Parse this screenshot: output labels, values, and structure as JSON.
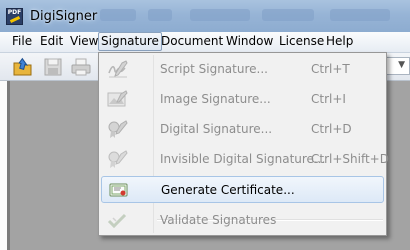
{
  "window": {
    "title": "DigiSigner",
    "app_icon_text": "PDF"
  },
  "menubar": {
    "items": [
      "File",
      "Edit",
      "View",
      "Signature",
      "Document",
      "Window",
      "License",
      "Help"
    ],
    "active": "Signature"
  },
  "signature_menu": {
    "items": [
      {
        "label": "Script Signature...",
        "shortcut": "Ctrl+T",
        "enabled": false,
        "icon": "script-signature-icon"
      },
      {
        "label": "Image Signature...",
        "shortcut": "Ctrl+I",
        "enabled": false,
        "icon": "image-signature-icon"
      },
      {
        "label": "Digital Signature...",
        "shortcut": "Ctrl+D",
        "enabled": false,
        "icon": "digital-signature-icon"
      },
      {
        "label": "Invisible Digital Signature...",
        "shortcut": "Ctrl+Shift+D",
        "enabled": false,
        "icon": "invisible-signature-icon"
      },
      {
        "label": "Generate Certificate...",
        "shortcut": "",
        "enabled": true,
        "highlighted": true,
        "icon": "certificate-icon"
      },
      {
        "label": "Validate Signatures",
        "shortcut": "",
        "enabled": false,
        "icon": "validate-checkmark-icon"
      }
    ]
  },
  "colors": {
    "title_bar": "#97b4d6",
    "highlight_border": "#a8c5e6",
    "disabled_text": "#8d8d8d",
    "workspace": "#a3a3a3"
  }
}
